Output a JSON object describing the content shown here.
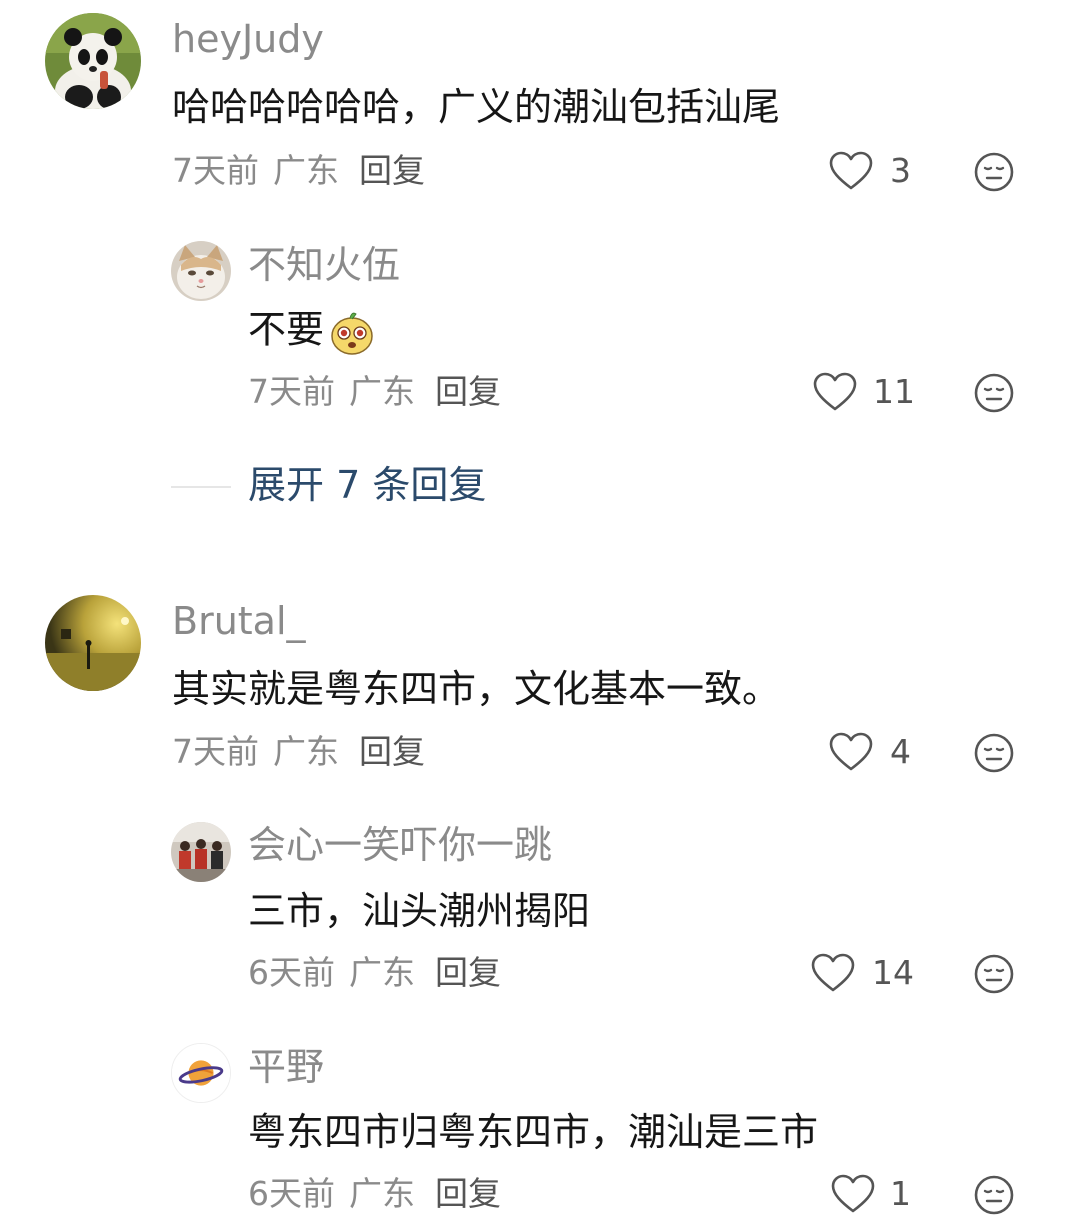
{
  "comments": [
    {
      "username": "heyJudy",
      "text": "哈哈哈哈哈哈，广义的潮汕包括汕尾",
      "time": "7天前",
      "location": "广东",
      "reply_label": "回复",
      "likes": "3",
      "avatar_icon": "panda-avatar",
      "replies": [
        {
          "username": "不知火伍",
          "text": "不要",
          "sticker": "cute-face-sticker",
          "time": "7天前",
          "location": "广东",
          "reply_label": "回复",
          "likes": "11",
          "avatar_icon": "cat-avatar"
        }
      ],
      "expand_label": "展开 7 条回复"
    },
    {
      "username": "Brutal_",
      "text": "其实就是粤东四市，文化基本一致。",
      "time": "7天前",
      "location": "广东",
      "reply_label": "回复",
      "likes": "4",
      "avatar_icon": "night-scene-avatar",
      "replies": [
        {
          "username": "会心一笑吓你一跳",
          "text": "三市，汕头潮州揭阳",
          "time": "6天前",
          "location": "广东",
          "reply_label": "回复",
          "likes": "14",
          "avatar_icon": "group-photo-avatar"
        },
        {
          "username": "平野",
          "text": "粤东四市归粤东四市，潮汕是三市",
          "time": "6天前",
          "location": "广东",
          "reply_label": "回复",
          "likes": "1",
          "avatar_icon": "planet-avatar"
        }
      ]
    }
  ],
  "colors": {
    "username": "#8a8a8a",
    "text": "#161616",
    "expand": "#2b4a6b",
    "icon": "#555555"
  }
}
